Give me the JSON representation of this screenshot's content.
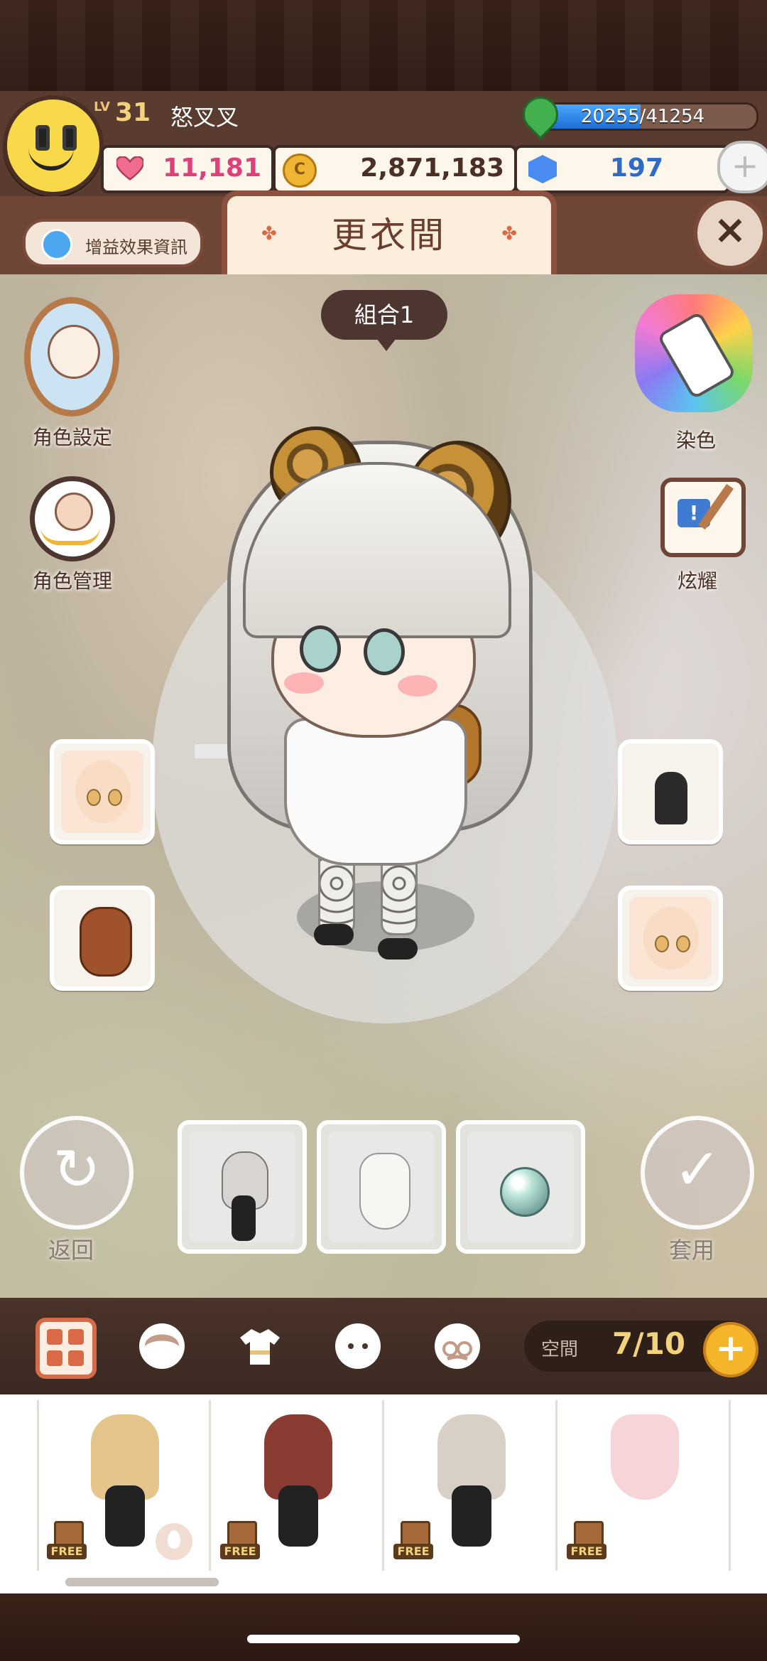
{
  "header": {
    "level_prefix": "LV",
    "level": "31",
    "player_name": "怒叉叉",
    "exp": "20255/41254",
    "exp_fraction": 0.491,
    "hearts": "11,181",
    "coins": "2,871,183",
    "gems": "197",
    "add_icon": "plus-icon"
  },
  "title_bar": {
    "boost_label": "增益效果資訊",
    "title": "更衣間",
    "close_icon": "close-icon",
    "ornament": "✤"
  },
  "scene": {
    "combo_label": "組合1",
    "left_buttons": [
      {
        "label": "角色設定",
        "icon": "character-settings-icon"
      },
      {
        "label": "角色管理",
        "icon": "character-manage-icon"
      }
    ],
    "right_buttons": [
      {
        "label": "染色",
        "icon": "dye-icon"
      },
      {
        "label": "炫耀",
        "icon": "show-off-icon"
      }
    ],
    "back_label": "返回",
    "apply_label": "套用"
  },
  "slots": {
    "left": [
      "face-slot",
      "bear-accessory-slot"
    ],
    "right": [
      "hair-accessory-slot",
      "face-slot-2"
    ]
  },
  "previews": [
    "hair-preview",
    "outfit-preview",
    "eye-preview"
  ],
  "tabs": {
    "items": [
      "all",
      "hair",
      "clothes",
      "face",
      "accessory"
    ],
    "selected": "all",
    "space_label": "空間",
    "space_value": "7/10"
  },
  "items": [
    {
      "name": "blonde-bun-hair",
      "badge": "FREE",
      "dyeable": true,
      "color": "#e6c58a"
    },
    {
      "name": "red-long-hair",
      "badge": "FREE",
      "dyeable": false,
      "color": "#8a3b32"
    },
    {
      "name": "straw-hat-hair",
      "badge": "FREE",
      "dyeable": false,
      "color": "#d8d0c6"
    },
    {
      "name": "pink-dress",
      "badge": "FREE",
      "dyeable": false,
      "color": "#f6d4d8"
    }
  ],
  "colors": {
    "accent": "#d96a48",
    "frame": "#6f4536",
    "gold": "#f3d37a"
  }
}
